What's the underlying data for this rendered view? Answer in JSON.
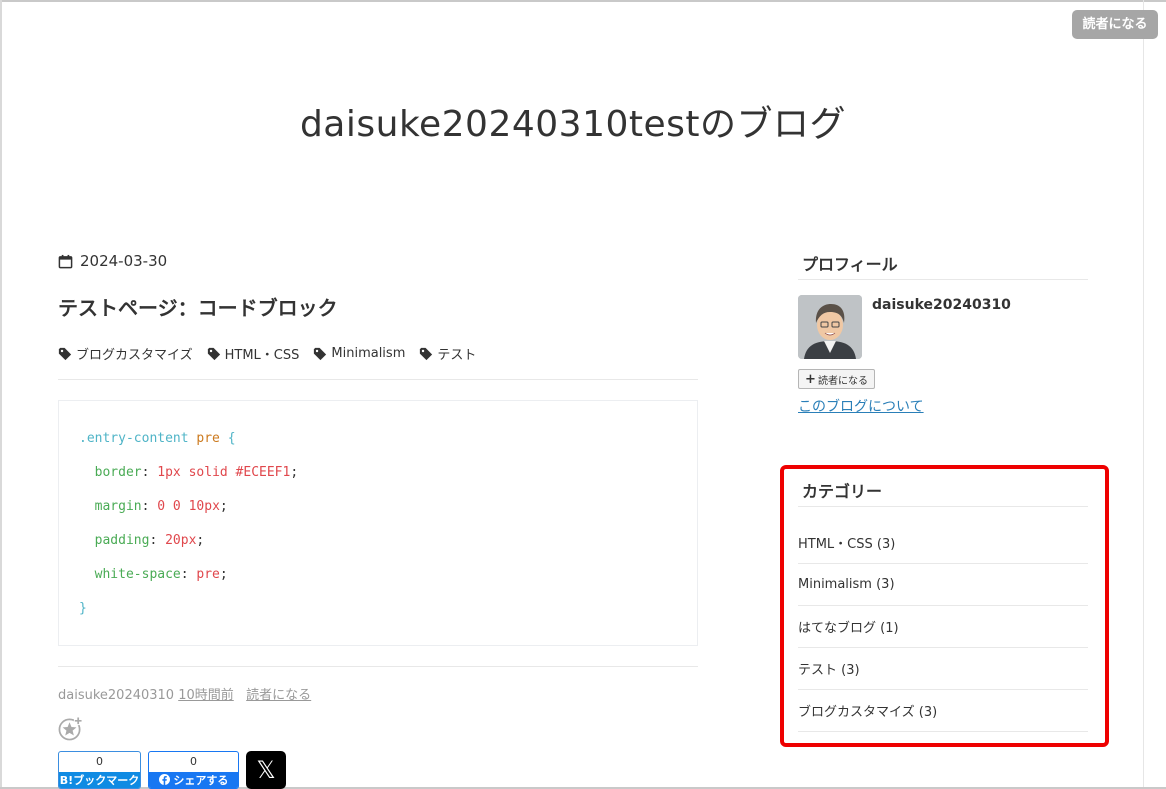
{
  "header": {
    "follow_button": "読者になる",
    "blog_title": "daisuke20240310testのブログ"
  },
  "entry": {
    "date": "2024-03-30",
    "title": "テストページ：コードブロック",
    "tags": [
      "ブログカスタマイズ",
      "HTML・CSS",
      "Minimalism",
      "テスト"
    ],
    "code": {
      "selector": ".entry-content",
      "element": "pre",
      "open_brace": "{",
      "close_brace": "}",
      "declarations": [
        {
          "property": "border",
          "value": "1px solid #ECEEF1"
        },
        {
          "property": "margin",
          "value": "0 0 10px"
        },
        {
          "property": "padding",
          "value": "20px"
        },
        {
          "property": "white-space",
          "value": "pre"
        }
      ]
    },
    "footer": {
      "author": "daisuke20240310",
      "time": "10時間前",
      "follow_link": "読者になる"
    },
    "share": {
      "hatena_count": "0",
      "hatena_label": "B!ブックマーク",
      "facebook_count": "0",
      "facebook_label": "シェアする",
      "x_label": "𝕏"
    }
  },
  "sidebar": {
    "profile": {
      "heading": "プロフィール",
      "name": "daisuke20240310",
      "follow_button": "読者になる",
      "about_link": "このブログについて"
    },
    "categories": {
      "heading": "カテゴリー",
      "items": [
        "HTML・CSS (3)",
        "Minimalism (3)",
        "はてなブログ (1)",
        "テスト (3)",
        "ブログカスタマイズ (3)"
      ]
    }
  },
  "colors": {
    "highlight": "#ee0000",
    "link": "#2a7fb8",
    "hatena_blue": "#0f8be3",
    "facebook_blue": "#1877f2"
  }
}
